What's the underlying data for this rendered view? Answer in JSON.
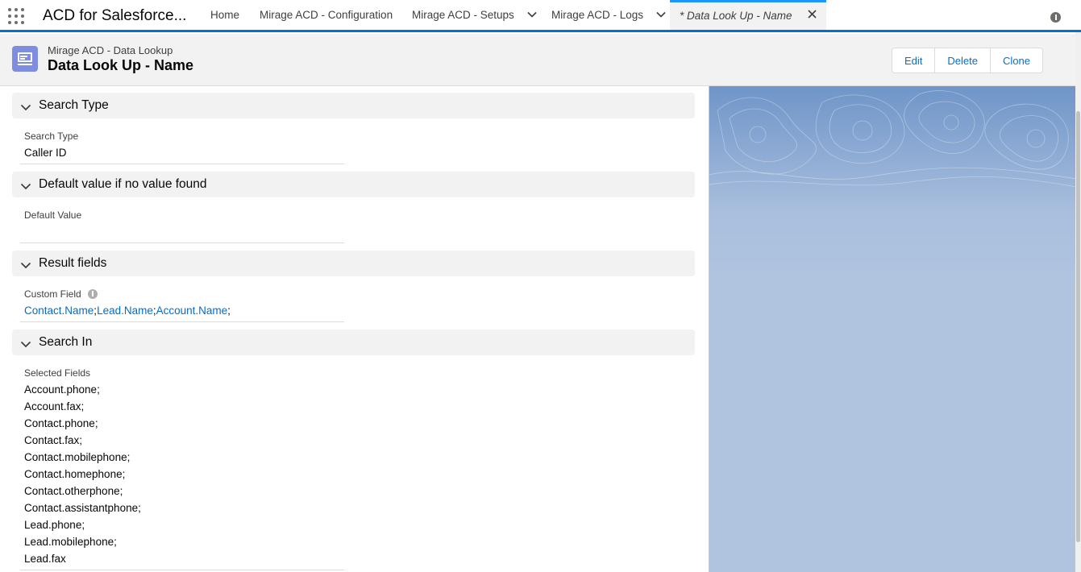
{
  "app": {
    "name": "ACD for Salesforce..."
  },
  "nav": {
    "items": [
      {
        "label": "Home"
      },
      {
        "label": "Mirage ACD - Configuration"
      },
      {
        "label": "Mirage ACD - Setups"
      },
      {
        "label": "Mirage ACD - Logs"
      }
    ],
    "active_tab": "* Data Look Up - Name"
  },
  "header": {
    "object_type": "Mirage ACD - Data Lookup",
    "record_name": "Data Look Up - Name",
    "buttons": {
      "edit": "Edit",
      "delete": "Delete",
      "clone": "Clone"
    }
  },
  "sections": {
    "search_type": {
      "title": "Search Type",
      "field_label": "Search Type",
      "field_value": "Caller ID"
    },
    "default_value": {
      "title": "Default value if no value found",
      "field_label": "Default Value",
      "field_value": ""
    },
    "result_fields": {
      "title": "Result fields",
      "field_label": "Custom Field",
      "links": [
        "Contact.Name",
        "Lead.Name",
        "Account.Name"
      ],
      "sep": ";"
    },
    "search_in": {
      "title": "Search In",
      "field_label": "Selected Fields",
      "values": [
        "Account.phone;",
        "Account.fax;",
        "Contact.phone;",
        "Contact.fax;",
        "Contact.mobilephone;",
        "Contact.homephone;",
        "Contact.otherphone;",
        "Contact.assistantphone;",
        "Lead.phone;",
        "Lead.mobilephone;",
        "Lead.fax"
      ]
    }
  },
  "colors": {
    "brand_blue": "#0070d2",
    "link_blue": "#006dcc",
    "object_icon": "#7f8de1",
    "section_bg": "#f3f2f2",
    "panel_bg": "#b0c4e0"
  }
}
